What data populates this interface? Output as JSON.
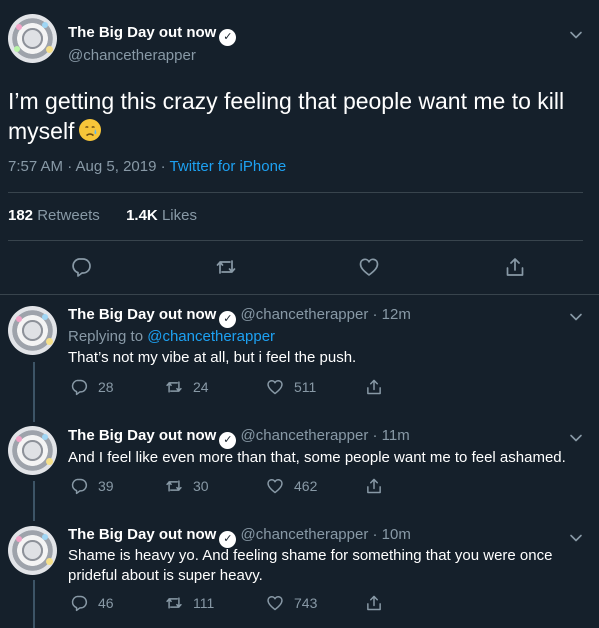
{
  "tweet": {
    "name": "The Big Day out now",
    "handle": "@chancetherapper",
    "text": "I’m getting this crazy feeling that people want me to kill myself",
    "emoji": "crying-face-emoji",
    "time": "7:57 AM · Aug 5, 2019",
    "source": "Twitter for iPhone",
    "retweets_count": "182",
    "retweets_label": "Retweets",
    "likes_count": "1.4K",
    "likes_label": "Likes"
  },
  "replies": [
    {
      "name": "The Big Day out now",
      "handle_time": "@chancetherapper · 12m",
      "replying_prefix": "Replying to",
      "replying_to": "@chancetherapper",
      "text": "That’s not my vibe at all, but i feel the push.",
      "replies": "28",
      "retweets": "24",
      "likes": "511"
    },
    {
      "name": "The Big Day out now",
      "handle_time": "@chancetherapper · 11m",
      "text": "And I feel like even more than that, some people want me to feel ashamed.",
      "replies": "39",
      "retweets": "30",
      "likes": "462"
    },
    {
      "name": "The Big Day out now",
      "handle_time": "@chancetherapper · 10m",
      "text": "Shame is heavy yo. And feeling shame for something that you were once prideful about is super heavy.",
      "replies": "46",
      "retweets": "111",
      "likes": "743"
    }
  ],
  "colors": {
    "background": "#15202b",
    "secondary_text": "#8899a6",
    "link": "#1da1f2",
    "divider": "#38444d"
  }
}
